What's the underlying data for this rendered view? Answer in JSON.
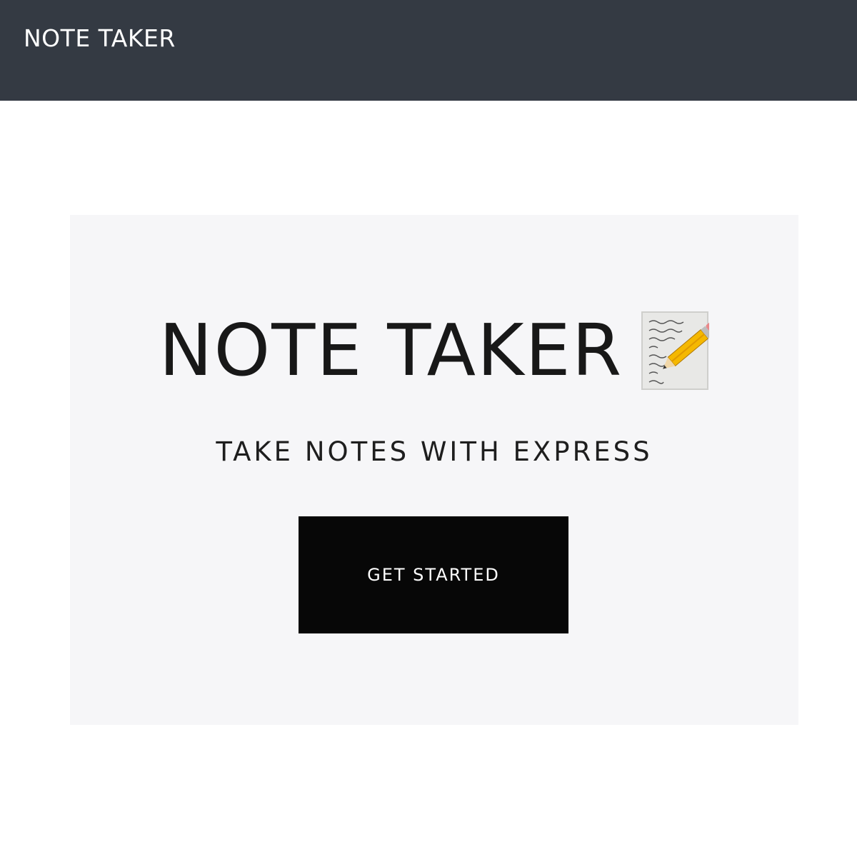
{
  "navbar": {
    "brand": "NOTE TAKER",
    "background": "#343a43"
  },
  "hero": {
    "title": "NOTE TAKER",
    "icon": "memo-icon",
    "subtitle": "TAKE NOTES WITH EXPRESS",
    "button_label": "GET STARTED",
    "background": "#f6f6f8",
    "button_color": "#070707"
  }
}
